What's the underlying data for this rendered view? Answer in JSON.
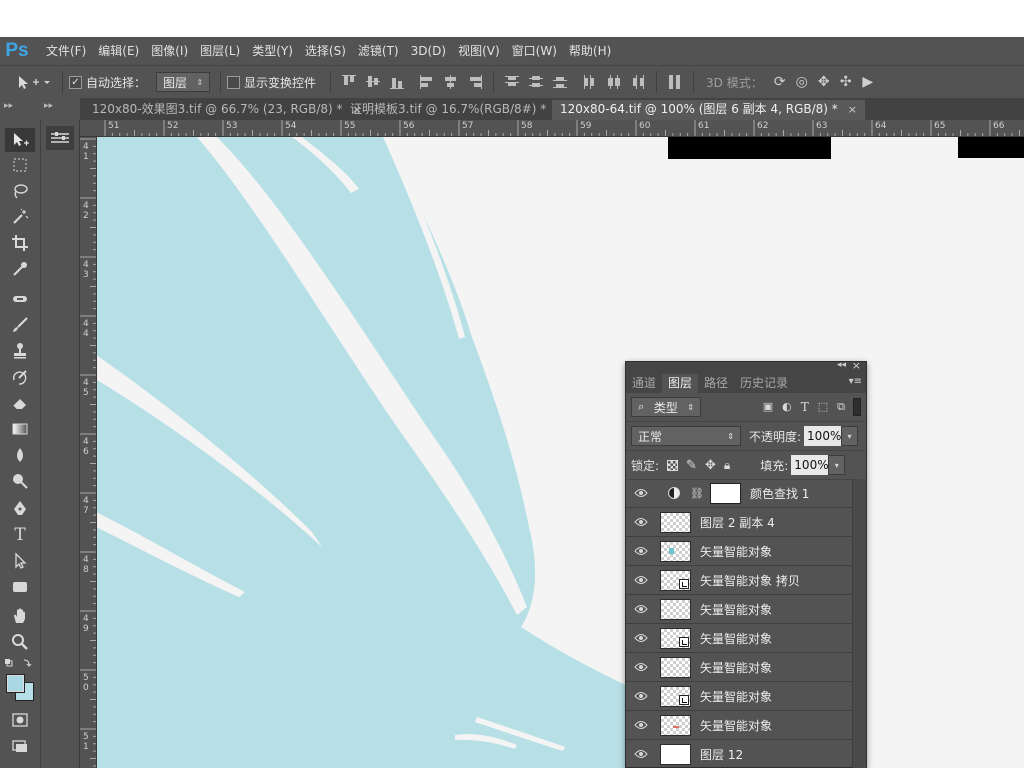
{
  "app": {
    "logo": "Ps"
  },
  "menu": [
    "文件(F)",
    "编辑(E)",
    "图像(I)",
    "图层(L)",
    "类型(Y)",
    "选择(S)",
    "滤镜(T)",
    "3D(D)",
    "视图(V)",
    "窗口(W)",
    "帮助(H)"
  ],
  "options": {
    "auto_select_label": "自动选择：",
    "auto_select_checked": true,
    "auto_select_target": "图层",
    "show_transform_label": "显示变换控件",
    "mode_3d_label": "3D 模式："
  },
  "tabs": [
    {
      "title": "120x80-效果图3.tif @ 66.7% (23, RGB/8) *",
      "active": false
    },
    {
      "title": "证明模板3.tif @ 16.7%(RGB/8#) *",
      "active": false
    },
    {
      "title": "120x80-64.tif @ 100% (图层 6 副本 4, RGB/8) *",
      "active": true
    }
  ],
  "ruler": {
    "top": [
      "51",
      "52",
      "53",
      "54",
      "55",
      "56",
      "57",
      "58",
      "59",
      "60",
      "61",
      "62",
      "63",
      "64",
      "65",
      "66"
    ],
    "left": [
      "4 1",
      "4 2",
      "4 3",
      "4 4",
      "4 5",
      "4 6",
      "4 7",
      "4 8",
      "4 9",
      "5 0",
      "5 1"
    ]
  },
  "tools": [
    "move-tool",
    "marquee-tool",
    "lasso-tool",
    "magic-wand-tool",
    "crop-tool",
    "eyedropper-tool",
    "healing-tool",
    "brush-tool",
    "stamp-tool",
    "history-brush-tool",
    "eraser-tool",
    "gradient-tool",
    "blur-tool",
    "dodge-tool",
    "pen-tool",
    "type-tool",
    "path-select-tool",
    "shape-tool",
    "hand-tool",
    "zoom-tool"
  ],
  "colors": {
    "foreground": "#a9d7e3",
    "background": "#b6dfe8",
    "canvas_shape": "#b7e0e6",
    "canvas_bg": "#f4f4f4"
  },
  "layers_panel": {
    "tabs": [
      "通道",
      "图层",
      "路径",
      "历史记录"
    ],
    "active_tab": "图层",
    "filter_label": "类型",
    "blend_mode": "正常",
    "opacity_label": "不透明度:",
    "opacity_value": "100%",
    "lock_label": "锁定:",
    "fill_label": "填充:",
    "fill_value": "100%",
    "layers": [
      {
        "name": "颜色查找 1",
        "kind": "adjustment"
      },
      {
        "name": "图层 2 副本 4",
        "kind": "pixel"
      },
      {
        "name": "矢量智能对象",
        "kind": "smart"
      },
      {
        "name": "矢量智能对象 拷贝",
        "kind": "smart"
      },
      {
        "name": "矢量智能对象",
        "kind": "smart"
      },
      {
        "name": "矢量智能对象",
        "kind": "smart"
      },
      {
        "name": "矢量智能对象",
        "kind": "smart"
      },
      {
        "name": "矢量智能对象",
        "kind": "smart"
      },
      {
        "name": "矢量智能对象",
        "kind": "smart"
      },
      {
        "name": "图层 12",
        "kind": "pixel"
      }
    ]
  }
}
